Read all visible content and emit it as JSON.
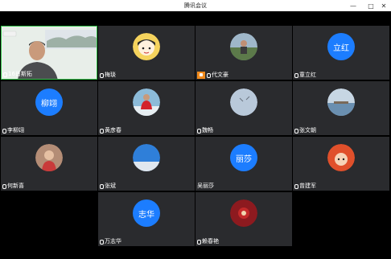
{
  "window": {
    "title": "腾讯会议",
    "minimize_icon": "minimize-icon",
    "maximize_icon": "maximize-icon",
    "close_icon": "close-icon"
  },
  "participants": [
    {
      "name": "16肖斯拓",
      "kind": "video",
      "muted_icon": "mic-icon"
    },
    {
      "name": "梅琰",
      "kind": "photo",
      "avatar_icon": "cartoon-girl-avatar"
    },
    {
      "name": "代文豪",
      "kind": "photo",
      "share_icon": "screen-share-icon",
      "avatar_icon": "landscape-avatar"
    },
    {
      "name": "童立红",
      "kind": "text",
      "avatar_text": "立红"
    },
    {
      "name": "李柳翊",
      "kind": "text",
      "avatar_text": "柳翊"
    },
    {
      "name": "黄彦春",
      "kind": "photo",
      "avatar_icon": "red-jacket-avatar"
    },
    {
      "name": "魏畅",
      "kind": "photo",
      "avatar_icon": "sky-avatar"
    },
    {
      "name": "张文朝",
      "kind": "photo",
      "avatar_icon": "lake-avatar"
    },
    {
      "name": "何新喜",
      "kind": "photo",
      "avatar_icon": "child-avatar"
    },
    {
      "name": "张斌",
      "kind": "photo",
      "avatar_icon": "blue-sky-avatar"
    },
    {
      "name": "吴丽莎",
      "kind": "text",
      "avatar_text": "丽莎"
    },
    {
      "name": "曾建军",
      "kind": "photo",
      "avatar_icon": "doll-avatar"
    },
    {
      "name": "万志华",
      "kind": "text",
      "avatar_text": "志华"
    },
    {
      "name": "赖春艳",
      "kind": "photo",
      "avatar_icon": "red-flower-avatar"
    }
  ],
  "colors": {
    "accent": "#1c7dff",
    "active_speaker": "#35c24a",
    "tile_bg": "#2a2b2e",
    "share": "#f08a1c"
  }
}
